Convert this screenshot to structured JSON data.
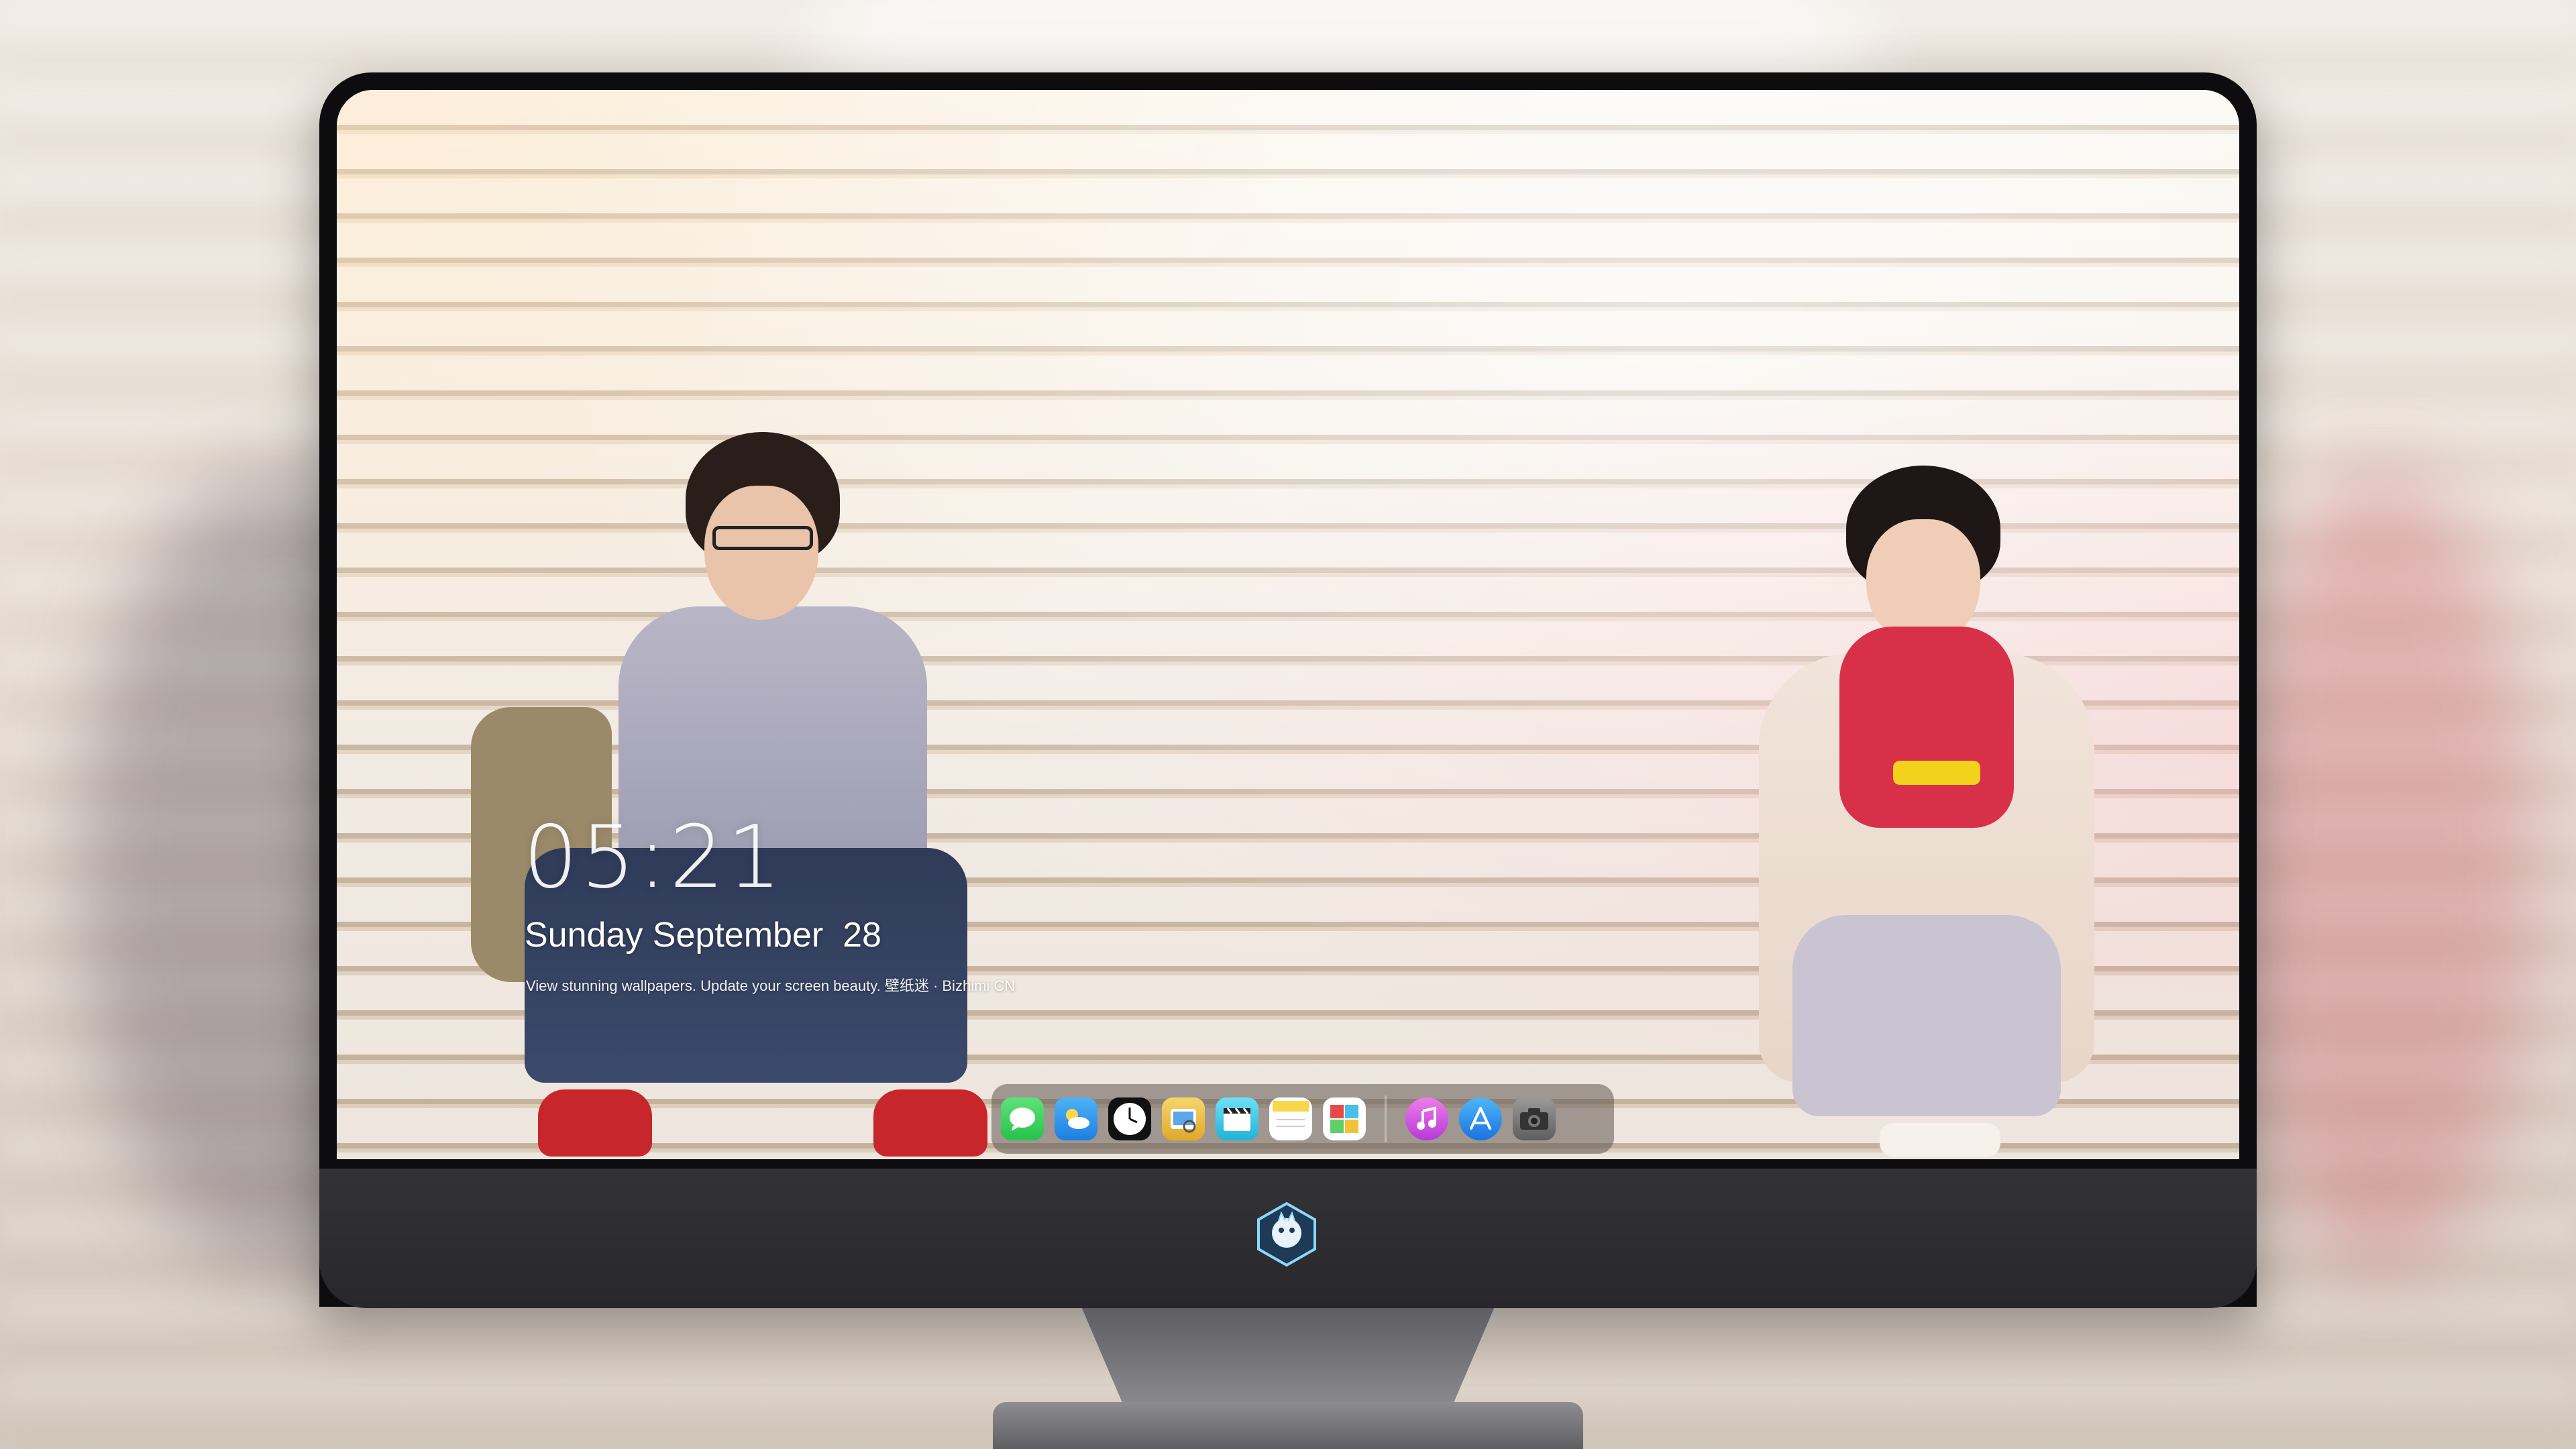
{
  "lock_screen": {
    "time": "05:21",
    "date": "Sunday September  28",
    "caption": "View stunning wallpapers. Update your screen beauty. 壁纸迷 · Bizhimi CN"
  },
  "dock": {
    "items": [
      {
        "name": "messages",
        "icon": "chat-bubble-icon",
        "color": "#2fd158"
      },
      {
        "name": "weather",
        "icon": "weather-icon",
        "color": "#3aa0f0"
      },
      {
        "name": "clock",
        "icon": "clock-icon",
        "color": "#1a1a1a"
      },
      {
        "name": "preview",
        "icon": "preview-icon",
        "color": "#f0c23a"
      },
      {
        "name": "videos",
        "icon": "clapperboard-icon",
        "color": "#3ac8e8"
      },
      {
        "name": "notes",
        "icon": "notes-icon",
        "color": "#f8d84a"
      },
      {
        "name": "photo-booth",
        "icon": "photo-booth-icon",
        "color": "#e84a4a"
      },
      {
        "name": "itunes",
        "icon": "music-note-icon",
        "color": "#d94ee0"
      },
      {
        "name": "app-store",
        "icon": "app-store-icon",
        "color": "#2a8cf0"
      },
      {
        "name": "camera",
        "icon": "camera-icon",
        "color": "#7a7a7a"
      }
    ]
  },
  "colors": {
    "bezel": "#0d0d0f",
    "chin": "#2e2d32",
    "scarf": "#d9304a",
    "phone": "#f3d21d"
  }
}
